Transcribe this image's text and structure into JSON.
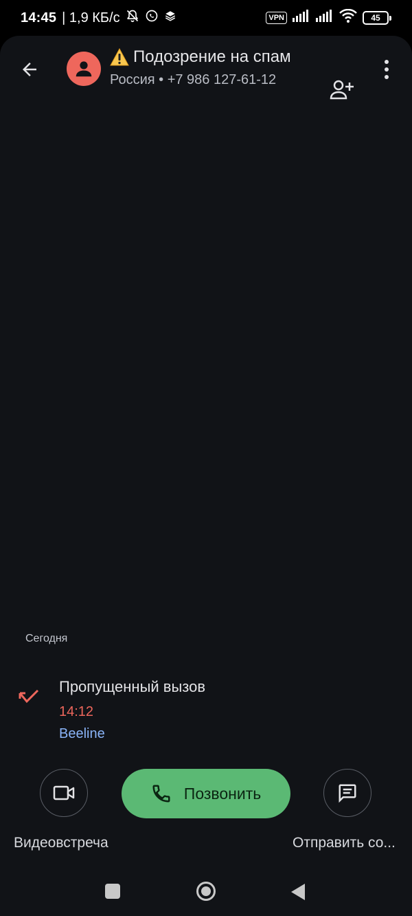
{
  "status_bar": {
    "time": "14:45",
    "speed": "| 1,9 КБ/с",
    "vpn_label": "VPN",
    "battery_level": "45"
  },
  "header": {
    "title": "Подозрение на спам",
    "subtitle": "Россия • +7 986 127-61-12"
  },
  "history": {
    "section_label": "Сегодня",
    "entries": [
      {
        "title": "Пропущенный вызов",
        "time": "14:12",
        "carrier": "Beeline"
      }
    ]
  },
  "actions": {
    "video_label": "Видеовстреча",
    "call_label": "Позвонить",
    "message_label": "Отправить со..."
  },
  "colors": {
    "background": "#111317",
    "avatar": "#ee675c",
    "missed": "#ee675c",
    "carrier": "#8ab4f8",
    "call_button": "#5bb974",
    "warning": "#f9c74f"
  },
  "icons": {
    "back": "arrow-left-icon",
    "avatar": "person-icon",
    "warning": "warning-triangle-icon",
    "add_contact": "person-add-icon",
    "more": "more-vertical-icon",
    "missed_call": "missed-call-icon",
    "video": "videocam-icon",
    "phone": "phone-icon",
    "message": "message-icon"
  }
}
